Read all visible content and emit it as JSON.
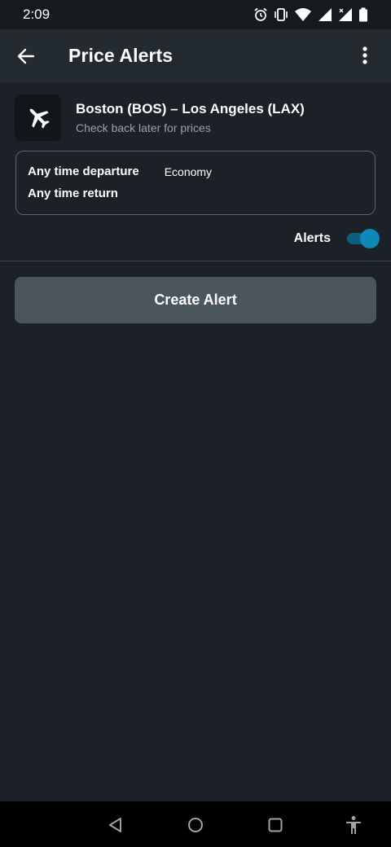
{
  "status_bar": {
    "time": "2:09",
    "icons": [
      "alarm-icon",
      "vibrate-icon",
      "wifi-icon",
      "signal-icon",
      "signal-roaming-icon",
      "battery-icon"
    ]
  },
  "app_bar": {
    "title": "Price Alerts",
    "back_icon": "arrow-back-icon",
    "menu_icon": "more-vert-icon"
  },
  "route": {
    "icon": "airplane-icon",
    "title": "Boston (BOS) – Los Angeles (LAX)",
    "subtitle": "Check back later for prices"
  },
  "details": {
    "departure": "Any time departure",
    "cabin": "Economy",
    "return": "Any time return"
  },
  "alerts": {
    "label": "Alerts",
    "enabled": true,
    "accent_color": "#0f88b8"
  },
  "create_button": {
    "label": "Create Alert"
  },
  "nav_bar": {
    "icons": [
      "back-triangle-icon",
      "home-circle-icon",
      "recents-square-icon",
      "accessibility-icon"
    ]
  }
}
